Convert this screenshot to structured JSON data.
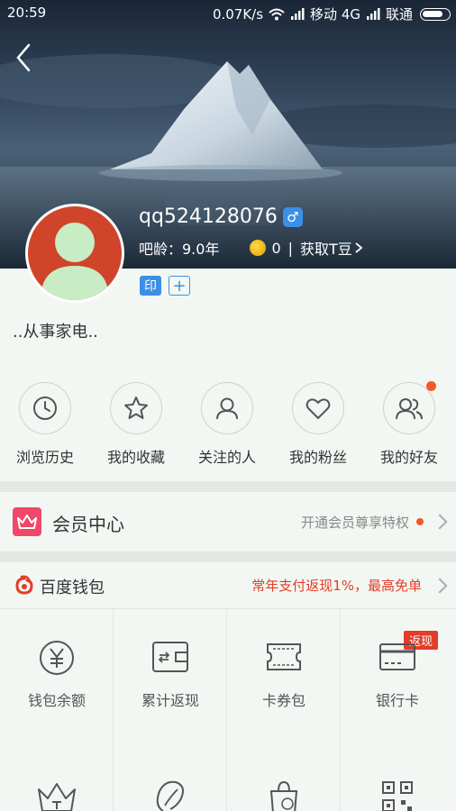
{
  "status": {
    "time": "20:59",
    "network_speed": "0.07K/s",
    "carrier1": "移动 4G",
    "carrier2": "联通"
  },
  "profile": {
    "username": "qq524128076",
    "gender_symbol": "♂",
    "age_label": "吧龄：9.0年",
    "t_beans": "0",
    "separator": "|",
    "get_beans": "获取T豆",
    "badge_yin": "印",
    "badge_plus": "+",
    "bio": "..从事家电.."
  },
  "quick_actions": [
    {
      "label": "浏览历史",
      "icon": "clock-icon"
    },
    {
      "label": "我的收藏",
      "icon": "star-icon"
    },
    {
      "label": "关注的人",
      "icon": "person-icon"
    },
    {
      "label": "我的粉丝",
      "icon": "heart-icon"
    },
    {
      "label": "我的好友",
      "icon": "friends-icon",
      "has_dot": true
    }
  ],
  "member": {
    "title": "会员中心",
    "promo": "开通会员尊享特权"
  },
  "wallet": {
    "title": "百度钱包",
    "promo": "常年支付返现1%，最高免单",
    "items": [
      {
        "label": "钱包余额",
        "icon": "yen-icon"
      },
      {
        "label": "累计返现",
        "icon": "wallet-icon"
      },
      {
        "label": "卡券包",
        "icon": "ticket-icon"
      },
      {
        "label": "银行卡",
        "icon": "bankcard-icon",
        "tag": "返现"
      }
    ]
  },
  "colors": {
    "accent_blue": "#3b8fe6",
    "promo_red": "#e23d28",
    "member_pink": "#f0486a",
    "avatar_red": "#d0442a"
  }
}
